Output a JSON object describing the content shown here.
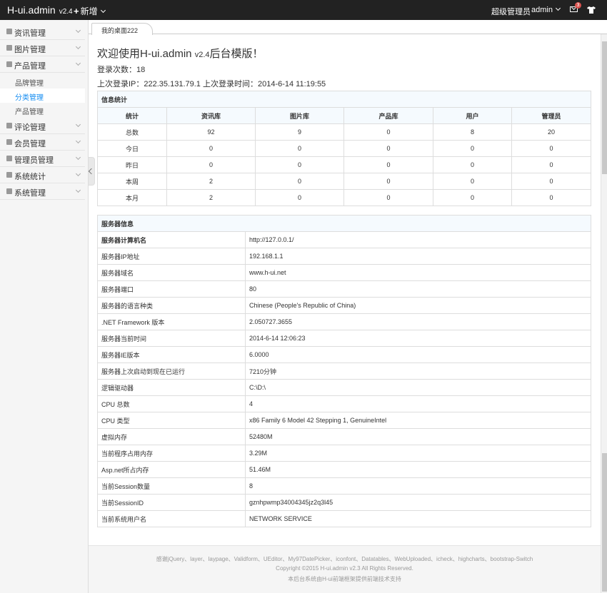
{
  "topbar": {
    "logo": "H-ui.admin",
    "version": "v2.4",
    "add_new": "新增",
    "role": "超级管理员",
    "user": "admin",
    "msg_count": "3",
    "icons": [
      "plus-icon",
      "chevron-down-icon",
      "message-icon",
      "skin-shirt-icon"
    ]
  },
  "sidebar": {
    "items": [
      {
        "label": "资讯管理",
        "icon": "news-icon"
      },
      {
        "label": "图片管理",
        "icon": "picture-icon"
      },
      {
        "label": "产品管理",
        "icon": "product-icon"
      },
      {
        "label": "评论管理",
        "icon": "comment-icon"
      },
      {
        "label": "会员管理",
        "icon": "member-icon"
      },
      {
        "label": "管理员管理",
        "icon": "admin-icon"
      },
      {
        "label": "系统统计",
        "icon": "stats-icon"
      },
      {
        "label": "系统管理",
        "icon": "settings-icon"
      }
    ],
    "product_sub": [
      {
        "label": "品牌管理",
        "active": false
      },
      {
        "label": "分类管理",
        "active": true
      },
      {
        "label": "产品管理",
        "active": false
      }
    ]
  },
  "tabs": [
    {
      "label": "我的桌面222",
      "active": true
    }
  ],
  "main": {
    "welcome_prefix": "欢迎使用H-ui.admin ",
    "welcome_version": "v2.4",
    "welcome_suffix": "后台模版！",
    "login_count": "登录次数：18",
    "last_login": "上次登录IP：222.35.131.79.1  上次登录时间：2014-6-14 11:19:55"
  },
  "stats": {
    "caption": "信息统计",
    "headers": [
      "统计",
      "资讯库",
      "图片库",
      "产品库",
      "用户",
      "管理员"
    ],
    "rows": [
      [
        "总数",
        "92",
        "9",
        "0",
        "8",
        "20"
      ],
      [
        "今日",
        "0",
        "0",
        "0",
        "0",
        "0"
      ],
      [
        "昨日",
        "0",
        "0",
        "0",
        "0",
        "0"
      ],
      [
        "本周",
        "2",
        "0",
        "0",
        "0",
        "0"
      ],
      [
        "本月",
        "2",
        "0",
        "0",
        "0",
        "0"
      ]
    ]
  },
  "server": {
    "caption": "服务器信息",
    "rows": [
      [
        "服务器计算机名",
        "http://127.0.0.1/"
      ],
      [
        "服务器IP地址",
        "192.168.1.1"
      ],
      [
        "服务器域名",
        "www.h-ui.net"
      ],
      [
        "服务器端口",
        "80"
      ],
      [
        "服务器的语言种类",
        "Chinese (People's Republic of China)"
      ],
      [
        ".NET Framework 版本",
        "2.050727.3655"
      ],
      [
        "服务器当前时间",
        "2014-6-14 12:06:23"
      ],
      [
        "服务器IE版本",
        "6.0000"
      ],
      [
        "服务器上次启动到现在已运行",
        "7210分钟"
      ],
      [
        "逻辑驱动器",
        "C:\\D:\\"
      ],
      [
        "CPU 总数",
        "4"
      ],
      [
        "CPU 类型",
        "x86 Family 6 Model 42 Stepping 1, GenuineIntel"
      ],
      [
        "虚拟内存",
        "52480M"
      ],
      [
        "当前程序占用内存",
        "3.29M"
      ],
      [
        "Asp.net所占内存",
        "51.46M"
      ],
      [
        "当前Session数量",
        "8"
      ],
      [
        "当前SessionID",
        "gznhpwmp34004345jz2q3l45"
      ],
      [
        "当前系统用户名",
        "NETWORK SERVICE"
      ]
    ]
  },
  "footer": {
    "line1": "感谢jQuery、layer、laypage、Validform、UEditor、My97DatePicker、iconfont、Datatables、WebUploaded、icheck、highcharts、bootstrap-Switch",
    "line2": "Copyright ©2015 H-ui.admin v2.3 All Rights Reserved.",
    "line3": "本后台系统由H-ui前端框架提供前端技术支持"
  }
}
